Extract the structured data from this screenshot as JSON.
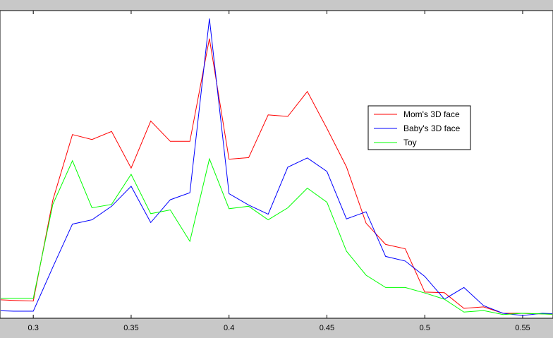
{
  "chart_data": {
    "type": "line",
    "title": "",
    "xlabel": "",
    "ylabel": "",
    "xlim": [
      0.283,
      0.5655
    ],
    "ylim": [
      0,
      1
    ],
    "x_ticks": [
      0.3,
      0.35,
      0.4,
      0.45,
      0.5,
      0.55
    ],
    "x_tick_labels": [
      "0.3",
      "0.35",
      "0.4",
      "0.45",
      "0.5",
      "0.55"
    ],
    "grid": false,
    "legend_position": "right",
    "x": [
      0.28,
      0.29,
      0.3,
      0.31,
      0.32,
      0.33,
      0.34,
      0.35,
      0.36,
      0.37,
      0.38,
      0.39,
      0.4,
      0.41,
      0.42,
      0.43,
      0.44,
      0.45,
      0.46,
      0.47,
      0.48,
      0.49,
      0.5,
      0.51,
      0.52,
      0.53,
      0.54,
      0.55,
      0.56,
      0.57
    ],
    "series": [
      {
        "name": "Mom's 3D face",
        "color": "#ff0000",
        "values": [
          0.061,
          0.058,
          0.056,
          0.384,
          0.597,
          0.581,
          0.607,
          0.488,
          0.641,
          0.575,
          0.575,
          0.909,
          0.517,
          0.522,
          0.661,
          0.656,
          0.737,
          0.617,
          0.492,
          0.309,
          0.24,
          0.226,
          0.085,
          0.083,
          0.032,
          0.037,
          0.016,
          0.016,
          0.014,
          0.012
        ]
      },
      {
        "name": "Baby's 3D face",
        "color": "#0000ff",
        "values": [
          0.025,
          0.023,
          0.023,
          0.166,
          0.306,
          0.32,
          0.364,
          0.429,
          0.311,
          0.385,
          0.408,
          0.974,
          0.405,
          0.368,
          0.338,
          0.491,
          0.521,
          0.477,
          0.323,
          0.346,
          0.201,
          0.186,
          0.136,
          0.062,
          0.1,
          0.041,
          0.016,
          0.009,
          0.016,
          0.014
        ]
      },
      {
        "name": "Toy",
        "color": "#00ff00",
        "values": [
          0.065,
          0.065,
          0.065,
          0.37,
          0.512,
          0.359,
          0.37,
          0.468,
          0.34,
          0.352,
          0.25,
          0.518,
          0.356,
          0.364,
          0.32,
          0.359,
          0.423,
          0.377,
          0.218,
          0.14,
          0.1,
          0.1,
          0.082,
          0.062,
          0.02,
          0.025,
          0.012,
          0.016,
          0.014,
          0.012
        ]
      }
    ]
  }
}
